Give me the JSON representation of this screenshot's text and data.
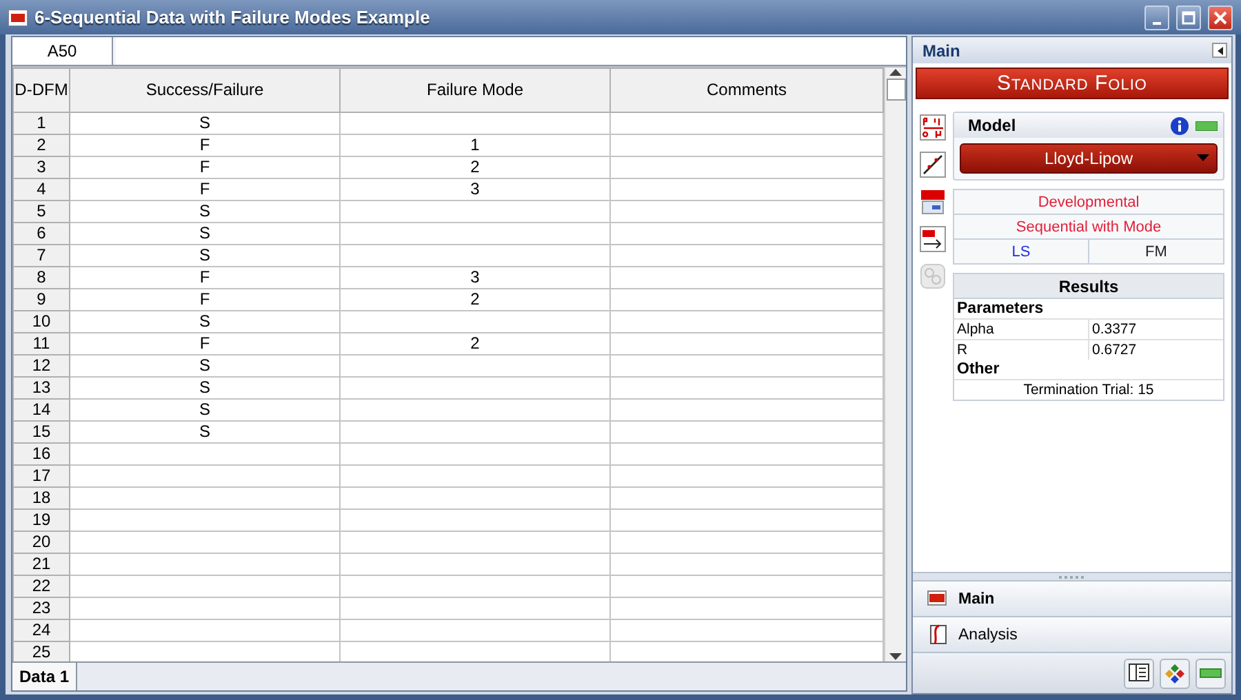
{
  "window": {
    "title": "6-Sequential Data with Failure Modes Example"
  },
  "grid": {
    "cell_ref": "A50",
    "columns": [
      "D-DFM",
      "Success/Failure",
      "Failure Mode",
      "Comments"
    ],
    "rows": [
      {
        "number": "1",
        "success_failure": "S"
      },
      {
        "number": "2",
        "success_failure": "F",
        "failure_mode": "1"
      },
      {
        "number": "3",
        "success_failure": "F",
        "failure_mode": "2"
      },
      {
        "number": "4",
        "success_failure": "F",
        "failure_mode": "3"
      },
      {
        "number": "5",
        "success_failure": "S"
      },
      {
        "number": "6",
        "success_failure": "S"
      },
      {
        "number": "7",
        "success_failure": "S"
      },
      {
        "number": "8",
        "success_failure": "F",
        "failure_mode": "3"
      },
      {
        "number": "9",
        "success_failure": "F",
        "failure_mode": "2"
      },
      {
        "number": "10",
        "success_failure": "S"
      },
      {
        "number": "11",
        "success_failure": "F",
        "failure_mode": "2"
      },
      {
        "number": "12",
        "success_failure": "S"
      },
      {
        "number": "13",
        "success_failure": "S"
      },
      {
        "number": "14",
        "success_failure": "S"
      },
      {
        "number": "15",
        "success_failure": "S"
      },
      {
        "number": "16"
      },
      {
        "number": "17"
      },
      {
        "number": "18"
      },
      {
        "number": "19"
      },
      {
        "number": "20"
      },
      {
        "number": "21"
      },
      {
        "number": "22"
      },
      {
        "number": "23"
      },
      {
        "number": "24"
      },
      {
        "number": "25"
      }
    ],
    "sheet_tabs": [
      {
        "label": "Data 1",
        "selected": true
      }
    ]
  },
  "panel": {
    "header": "Main",
    "banner": "Standard Folio",
    "side_tools": [
      {
        "kind": "parameters",
        "disabled": false
      },
      {
        "kind": "plot",
        "disabled": false
      },
      {
        "kind": "qcp",
        "disabled": false
      },
      {
        "kind": "calc",
        "disabled": false
      },
      {
        "kind": "transform",
        "disabled": true
      }
    ],
    "model": {
      "label": "Model",
      "value": "Lloyd-Lipow"
    },
    "settings": [
      "Developmental",
      "Sequential with Mode"
    ],
    "options": [
      {
        "label": "LS",
        "selected": true
      },
      {
        "label": "FM",
        "selected": false
      }
    ],
    "results": {
      "title": "Results",
      "sections": [
        {
          "heading": "Parameters",
          "rows": [
            {
              "name": "Alpha",
              "value": "0.3377"
            },
            {
              "name": "R",
              "value": "0.6727"
            }
          ]
        },
        {
          "heading": "Other",
          "lines": [
            "Termination Trial: 15"
          ]
        }
      ]
    },
    "nav": [
      {
        "label": "Main",
        "selected": true,
        "kind": "main"
      },
      {
        "label": "Analysis",
        "selected": false,
        "kind": "analysis"
      }
    ]
  }
}
